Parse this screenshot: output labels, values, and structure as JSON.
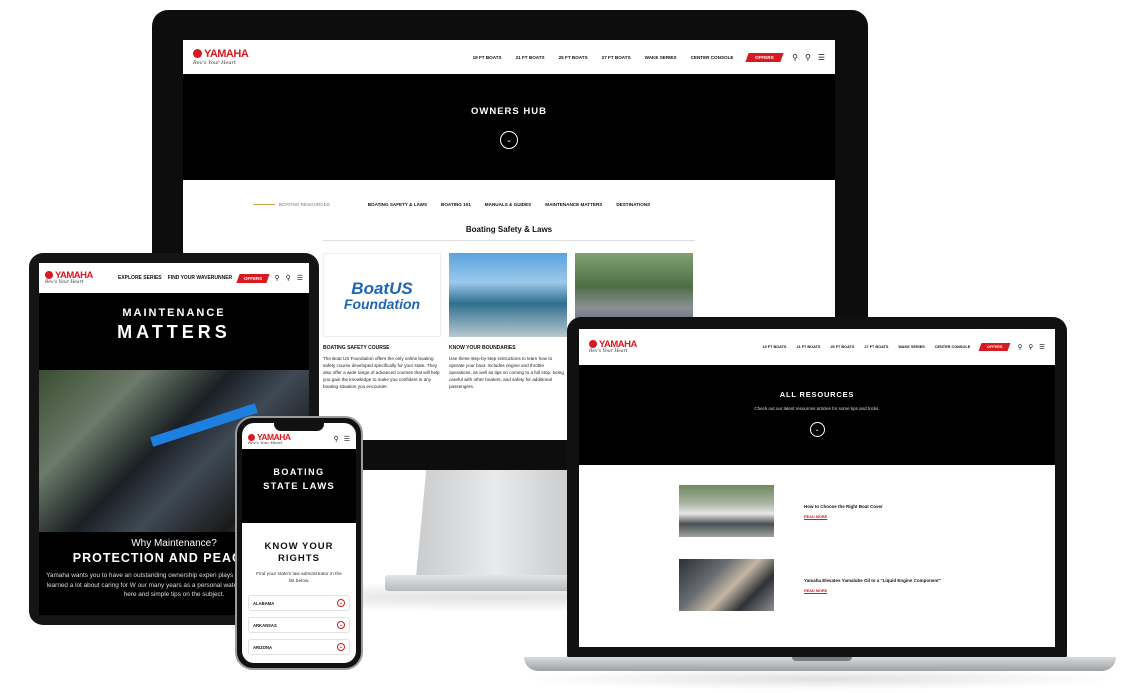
{
  "brand": {
    "logo": "YAMAHA",
    "tagline": "Rev's Your Heart"
  },
  "colors": {
    "brand_red": "#d71920",
    "accent_gold": "#c8a24a",
    "boatus_blue": "#1e66b3"
  },
  "monitor": {
    "nav": {
      "links": [
        "19 FT BOATS",
        "21 FT BOATS",
        "25 FT BOATS",
        "27 FT BOATS",
        "WAKE SERIES",
        "CENTER CONSOLE"
      ],
      "offers": "OFFERS",
      "icons": [
        "location-icon",
        "search-icon",
        "menu-icon"
      ]
    },
    "hero_title": "OWNERS HUB",
    "subnav": {
      "resources_label": "BOATING RESOURCES",
      "items": [
        "BOATING SAFETY & LAWS",
        "BOATING 101",
        "MANUALS & GUIDES",
        "MAINTENANCE MATTERS",
        "DESTINATIONS"
      ]
    },
    "section_title": "Boating Safety & Laws",
    "cards": [
      {
        "logo_line1": "BoatUS",
        "logo_line2": "Foundation",
        "title": "BOATING SAFETY COURSE",
        "body": "The Boat US Foundation offers the only online boating safety course developed specifically for your state. They also offer a wide range of advanced courses that will help you gain the knowledge to make you confident in any boating situation you encounter."
      },
      {
        "title": "KNOW YOUR BOUNDARIES",
        "body": "Use these step-by-step instructions to learn how to operate your boat. Includes engine and throttle operations, as well as tips on coming to a full stop, being careful with other boaters, and safety for additional passengers."
      }
    ]
  },
  "tablet": {
    "nav": {
      "links": [
        "EXPLORE SERIES",
        "FIND YOUR WAVERUNNER"
      ],
      "offers": "OFFERS"
    },
    "hero_line1": "MAINTENANCE",
    "hero_line2": "MATTERS",
    "why": "Why Maintenance?",
    "headline": "PROTECTION AND PEACE OF",
    "body": "Yamaha wants you to have an outstanding ownership experi plays a big part in that. We've learned a lot about caring for W our many years as a personal watercraft manufacturer; so here and simple tips on the subject."
  },
  "phone": {
    "hero_line1": "BOATING",
    "hero_line2": "STATE LAWS",
    "know_line1": "KNOW YOUR",
    "know_line2": "RIGHTS",
    "subtitle": "Find your state's law administrator in the list below.",
    "states": [
      "ALABAMA",
      "ARKANSAS",
      "ARIZONA"
    ]
  },
  "laptop": {
    "nav": {
      "links": [
        "19 FT BOATS",
        "21 FT BOATS",
        "25 FT BOATS",
        "27 FT BOATS",
        "WAKE SERIES",
        "CENTER CONSOLE"
      ],
      "offers": "OFFERS"
    },
    "hero_title": "ALL RESOURCES",
    "hero_sub": "Check out our latest resources articles for some tips and tricks.",
    "articles": [
      {
        "title": "How to Choose the Right Boat Cover",
        "link": "READ MORE"
      },
      {
        "title": "Yamaha Elevates Yamalube Oil to a \"Liquid Engine Component\"",
        "link": "READ MORE"
      }
    ]
  }
}
